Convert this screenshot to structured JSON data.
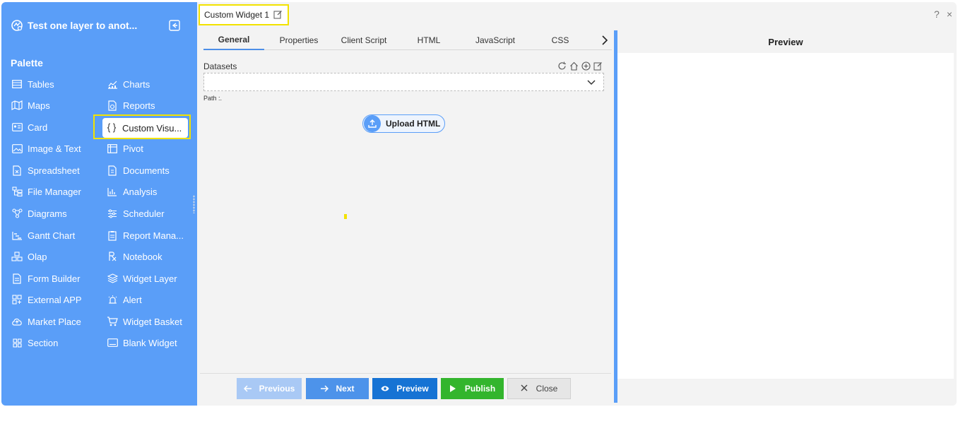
{
  "sidebar": {
    "title": "Test one layer to anot...",
    "palette_label": "Palette",
    "col1": [
      {
        "label": "Tables",
        "icon": "table-icon"
      },
      {
        "label": "Maps",
        "icon": "map-icon"
      },
      {
        "label": "Card",
        "icon": "card-icon"
      },
      {
        "label": "Image & Text",
        "icon": "image-icon"
      },
      {
        "label": "Spreadsheet",
        "icon": "spreadsheet-icon"
      },
      {
        "label": "File Manager",
        "icon": "file-manager-icon"
      },
      {
        "label": "Diagrams",
        "icon": "diagram-icon"
      },
      {
        "label": "Gantt Chart",
        "icon": "gantt-icon"
      },
      {
        "label": "Olap",
        "icon": "olap-icon"
      },
      {
        "label": "Form Builder",
        "icon": "form-icon"
      },
      {
        "label": "External APP",
        "icon": "external-app-icon"
      },
      {
        "label": "Market Place",
        "icon": "cloud-icon"
      },
      {
        "label": "Section",
        "icon": "section-icon"
      }
    ],
    "col2": [
      {
        "label": "Charts",
        "icon": "chart-icon"
      },
      {
        "label": "Reports",
        "icon": "report-icon"
      },
      {
        "label": "Custom Visu...",
        "icon": "braces-icon"
      },
      {
        "label": "Pivot",
        "icon": "pivot-icon"
      },
      {
        "label": "Documents",
        "icon": "document-icon"
      },
      {
        "label": "Analysis",
        "icon": "analysis-icon"
      },
      {
        "label": "Scheduler",
        "icon": "scheduler-icon"
      },
      {
        "label": "Report Mana...",
        "icon": "report-manager-icon"
      },
      {
        "label": "Notebook",
        "icon": "notebook-icon"
      },
      {
        "label": "Widget Layer",
        "icon": "layers-icon"
      },
      {
        "label": "Alert",
        "icon": "alert-icon"
      },
      {
        "label": "Widget Basket",
        "icon": "basket-icon"
      },
      {
        "label": "Blank Widget",
        "icon": "blank-widget-icon"
      }
    ]
  },
  "editor": {
    "widget_title": "Custom Widget 1",
    "tabs": [
      "General",
      "Properties",
      "Client Script",
      "HTML",
      "JavaScript",
      "CSS"
    ],
    "active_tab": "General",
    "datasets_label": "Datasets",
    "path_label": "Path :.",
    "upload_label": "Upload HTML",
    "buttons": {
      "previous": "Previous",
      "next": "Next",
      "preview": "Preview",
      "publish": "Publish",
      "close": "Close"
    }
  },
  "preview_panel": {
    "title": "Preview"
  },
  "window": {
    "help": "?",
    "close": "×"
  },
  "colors": {
    "sidebar": "#5a9ef8",
    "highlight": "#f2e200",
    "publish": "#33b52d",
    "preview_btn": "#1673d4"
  }
}
